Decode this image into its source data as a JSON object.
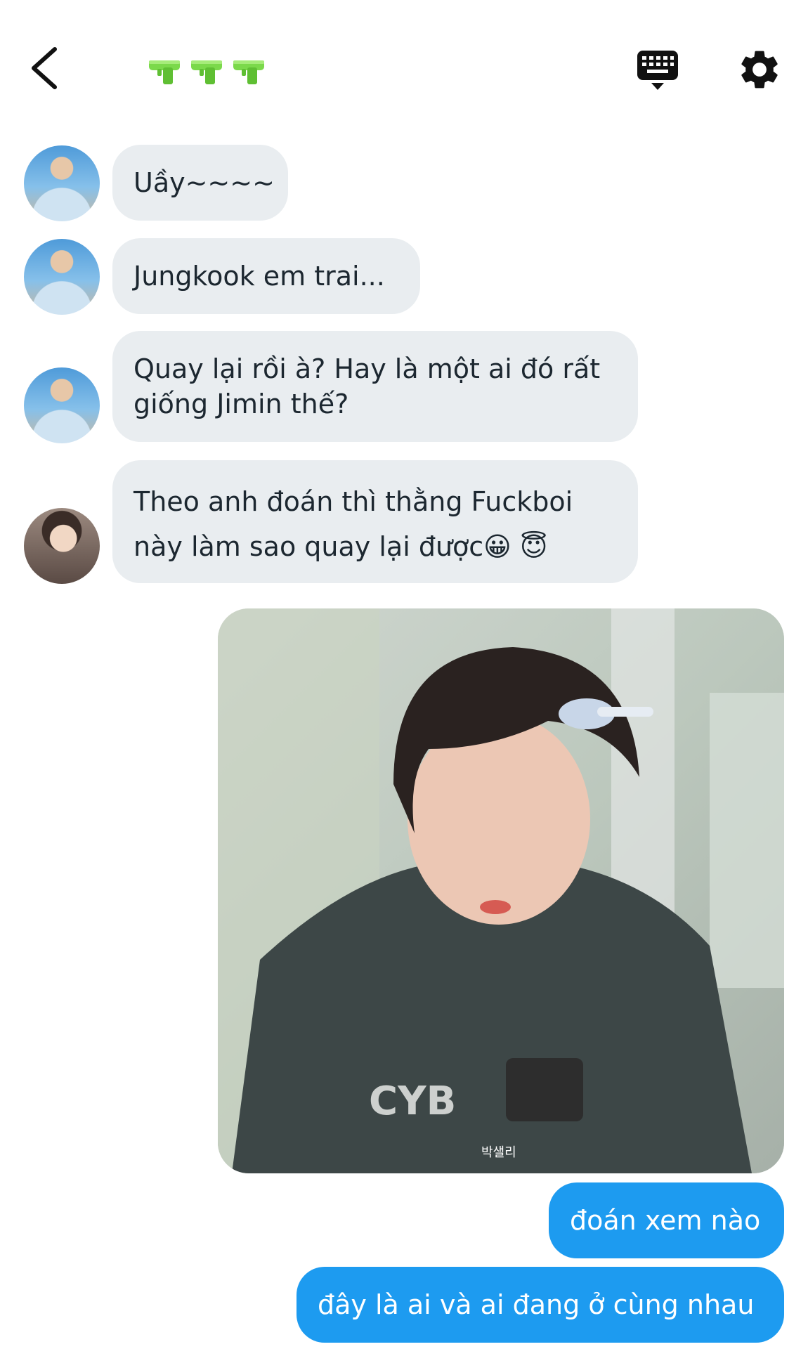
{
  "header": {
    "title_icons": [
      "water-pistol-icon",
      "water-pistol-icon",
      "water-pistol-icon"
    ],
    "back_icon": "chevron-left-icon",
    "keyboard_icon": "keyboard-icon",
    "settings_icon": "gear-icon"
  },
  "messages": [
    {
      "sender": "other",
      "text": "Uầy~~~~"
    },
    {
      "sender": "other",
      "text": "Jungkook em trai..."
    },
    {
      "sender": "other",
      "text_line1": "Quay lại rồi à? Hay là một ai đó rất",
      "text_line2": "giống Jimin thế?"
    },
    {
      "sender": "other2",
      "text_line1": "Theo anh đoán thì thằng Fuckboi",
      "text_line2": "này làm sao quay lại được😀 😇"
    },
    {
      "sender": "me",
      "type": "image",
      "caption": "박샐리"
    },
    {
      "sender": "me",
      "text": "đoán xem nào"
    },
    {
      "sender": "me",
      "text": "đây là ai và ai đang ở cùng nhau"
    }
  ],
  "colors": {
    "accent": "#1d9bf0",
    "bubble_in": "#e9edf0",
    "text": "#1c2730",
    "gun_green": "#7bd94b"
  }
}
